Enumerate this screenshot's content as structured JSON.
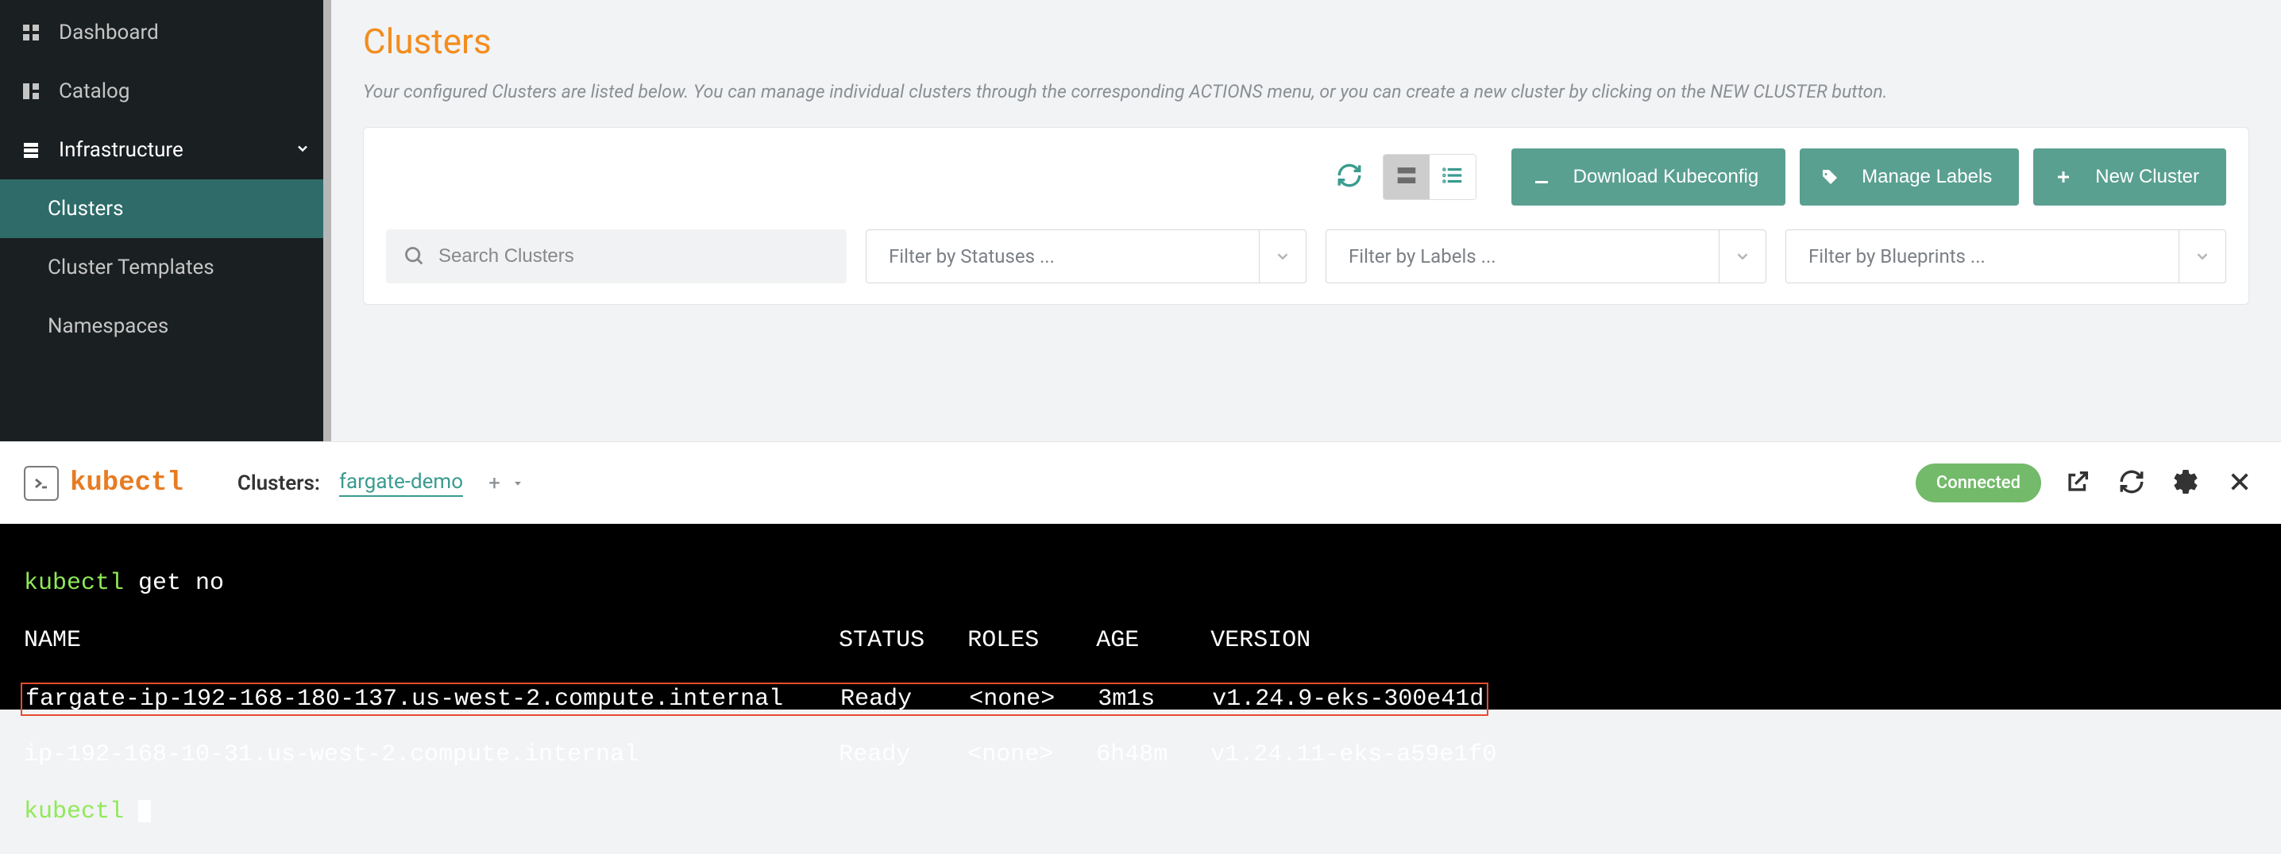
{
  "sidebar": {
    "items": [
      {
        "label": "Dashboard",
        "icon": "dashboard-icon"
      },
      {
        "label": "Catalog",
        "icon": "catalog-icon"
      },
      {
        "label": "Infrastructure",
        "icon": "infrastructure-icon",
        "expanded": true
      }
    ],
    "subitems": [
      {
        "label": "Clusters",
        "active": true
      },
      {
        "label": "Cluster Templates"
      },
      {
        "label": "Namespaces"
      }
    ]
  },
  "page": {
    "title": "Clusters",
    "description": "Your configured Clusters are listed below. You can manage individual clusters through the corresponding ACTIONS menu, or you can create a new cluster by clicking on the NEW CLUSTER button.",
    "download_label": "Download Kubeconfig",
    "manage_labels_label": "Manage Labels",
    "new_cluster_label": "New Cluster",
    "search_placeholder": "Search Clusters",
    "filter_status_placeholder": "Filter by Statuses ...",
    "filter_labels_placeholder": "Filter by Labels ...",
    "filter_blueprints_placeholder": "Filter by Blueprints ..."
  },
  "kubectl": {
    "brand": "kubectl",
    "clusters_label": "Clusters:",
    "cluster_name": "fargate-demo",
    "add_label": "+",
    "status_label": "Connected"
  },
  "terminal": {
    "prompt": "kubectl",
    "command": "get no",
    "header_cols": {
      "name": "NAME",
      "status": "STATUS",
      "roles": "ROLES",
      "age": "AGE",
      "version": "VERSION"
    },
    "rows": [
      {
        "name": "fargate-ip-192-168-180-137.us-west-2.compute.internal",
        "status": "Ready",
        "roles": "<none>",
        "age": "3m1s",
        "version": "v1.24.9-eks-300e41d",
        "highlighted": true
      },
      {
        "name": "ip-192-168-10-31.us-west-2.compute.internal",
        "status": "Ready",
        "roles": "<none>",
        "age": "6h48m",
        "version": "v1.24.11-eks-a59e1f0",
        "highlighted": false
      }
    ]
  }
}
